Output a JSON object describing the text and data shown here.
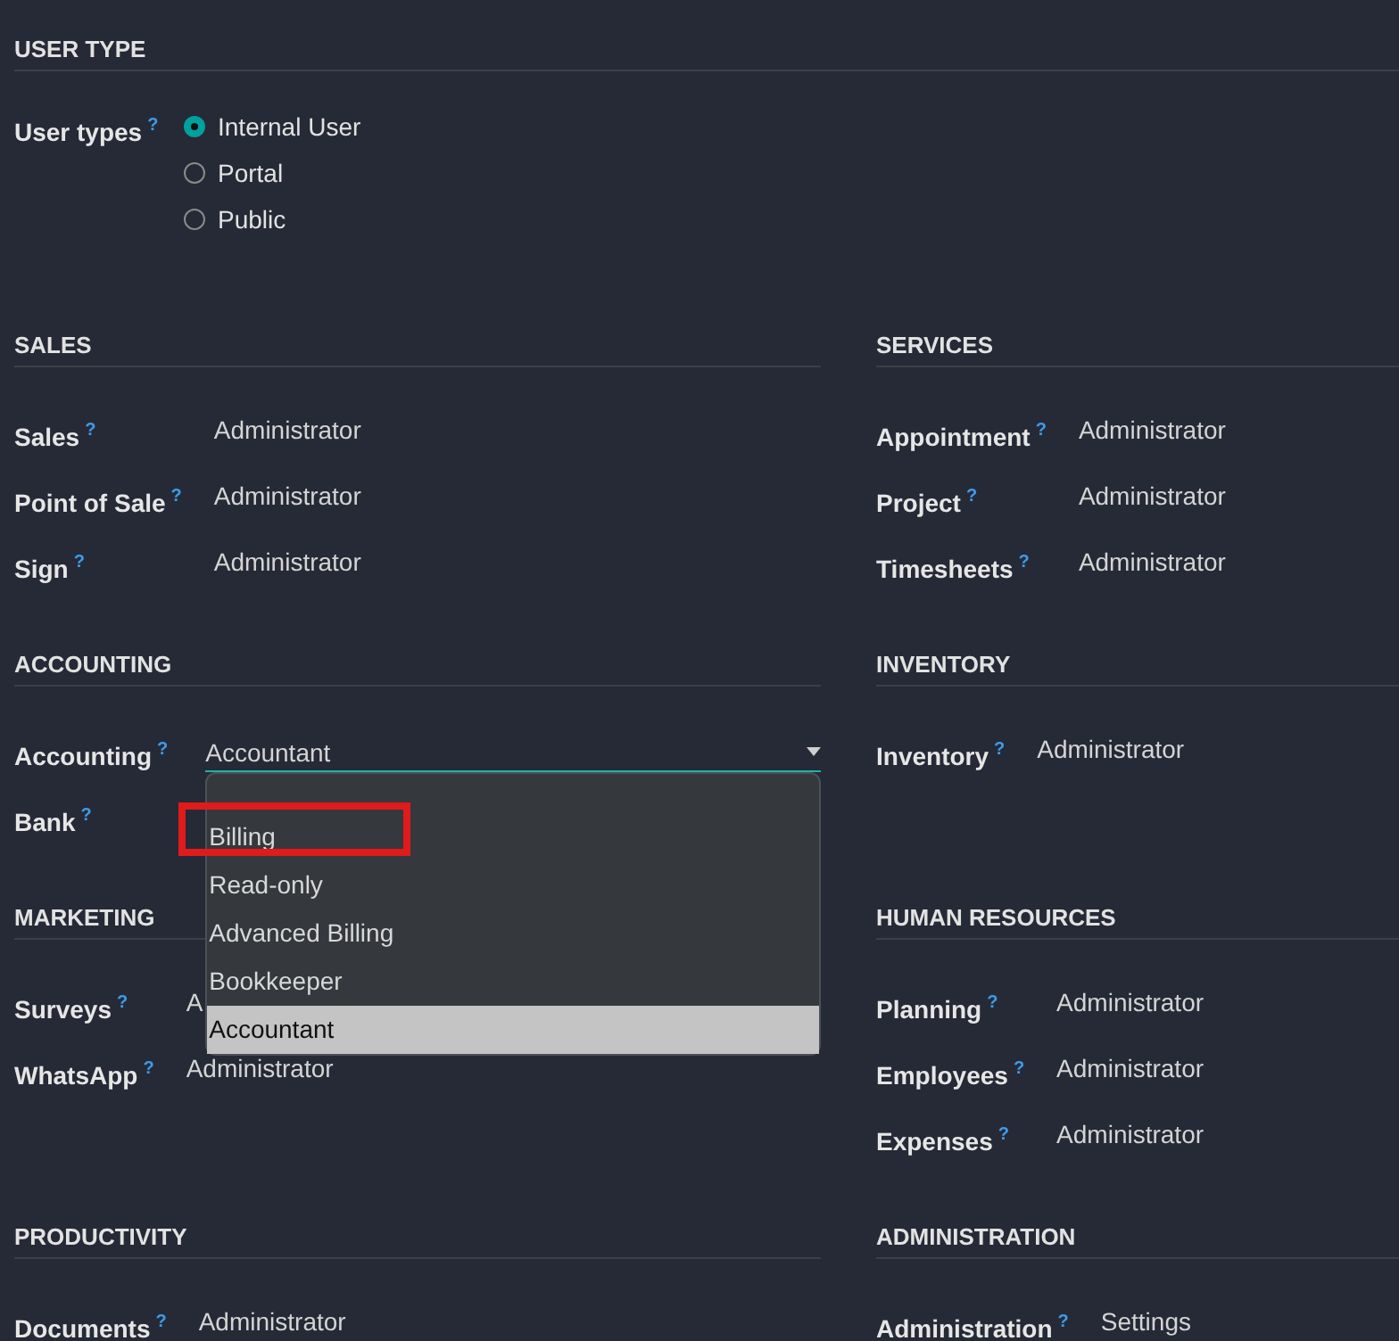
{
  "user_type": {
    "heading": "USER TYPE",
    "label": "User types",
    "help": "?",
    "options": [
      {
        "label": "Internal User",
        "selected": true
      },
      {
        "label": "Portal",
        "selected": false
      },
      {
        "label": "Public",
        "selected": false
      }
    ]
  },
  "sections": [
    {
      "heading": "SALES",
      "fields": [
        {
          "kind": "text",
          "label": "Sales",
          "help": "?",
          "value": "Administrator"
        },
        {
          "kind": "text",
          "label": "Point of Sale",
          "help": "?",
          "value": "Administrator"
        },
        {
          "kind": "text",
          "label": "Sign",
          "help": "?",
          "value": "Administrator"
        }
      ]
    },
    {
      "heading": "SERVICES",
      "fields": [
        {
          "kind": "text",
          "label": "Appointment",
          "help": "?",
          "value": "Administrator"
        },
        {
          "kind": "text",
          "label": "Project",
          "help": "?",
          "value": "Administrator"
        },
        {
          "kind": "text",
          "label": "Timesheets",
          "help": "?",
          "value": "Administrator"
        }
      ]
    },
    {
      "heading": "ACCOUNTING",
      "fields": [
        {
          "kind": "select",
          "label": "Accounting",
          "help": "?",
          "value": "Accountant",
          "expanded": true,
          "options": [
            {
              "label": "Billing",
              "selected": false,
              "highlighted": true
            },
            {
              "label": "Read-only",
              "selected": false,
              "highlighted": false
            },
            {
              "label": "Advanced Billing",
              "selected": false,
              "highlighted": false
            },
            {
              "label": "Bookkeeper",
              "selected": false,
              "highlighted": false
            },
            {
              "label": "Accountant",
              "selected": true,
              "highlighted": false
            }
          ]
        },
        {
          "kind": "text",
          "label": "Bank",
          "help": "?"
        }
      ]
    },
    {
      "heading": "INVENTORY",
      "fields": [
        {
          "kind": "text",
          "label": "Inventory",
          "help": "?",
          "value": "Administrator"
        }
      ]
    },
    {
      "heading": "MARKETING",
      "fields": [
        {
          "kind": "text",
          "label": "Surveys",
          "help": "?",
          "value": "A"
        },
        {
          "kind": "text",
          "label": "WhatsApp",
          "help": "?",
          "value": "Administrator"
        }
      ]
    },
    {
      "heading": "HUMAN RESOURCES",
      "fields": [
        {
          "kind": "text",
          "label": "Planning",
          "help": "?",
          "value": "Administrator"
        },
        {
          "kind": "text",
          "label": "Employees",
          "help": "?",
          "value": "Administrator"
        },
        {
          "kind": "text",
          "label": "Expenses",
          "help": "?",
          "value": "Administrator"
        }
      ]
    },
    {
      "heading": "PRODUCTIVITY",
      "fields": [
        {
          "kind": "text",
          "label": "Documents",
          "help": "?",
          "value": "Administrator"
        }
      ]
    },
    {
      "heading": "ADMINISTRATION",
      "fields": [
        {
          "kind": "text",
          "label": "Administration",
          "help": "?",
          "value": "Settings"
        }
      ]
    }
  ]
}
